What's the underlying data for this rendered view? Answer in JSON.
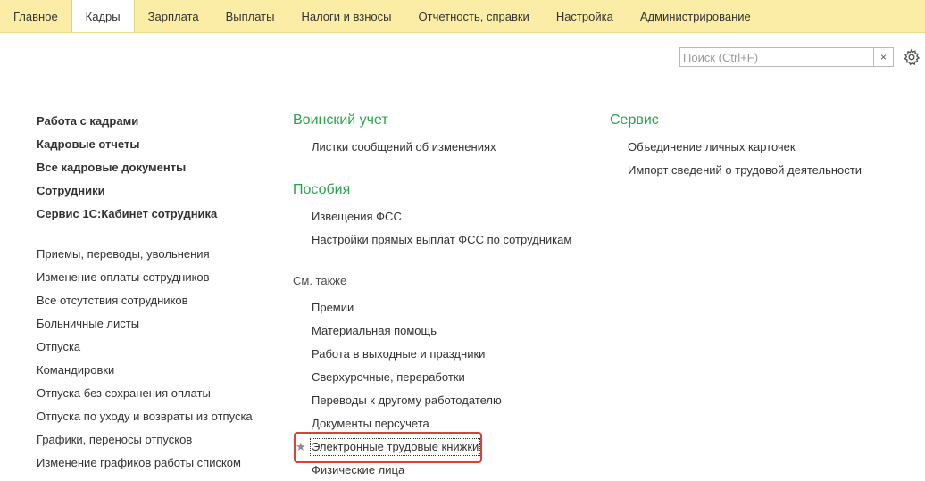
{
  "menubar": {
    "items": [
      {
        "label": "Главное",
        "active": false
      },
      {
        "label": "Кадры",
        "active": true
      },
      {
        "label": "Зарплата",
        "active": false
      },
      {
        "label": "Выплаты",
        "active": false
      },
      {
        "label": "Налоги и взносы",
        "active": false
      },
      {
        "label": "Отчетность, справки",
        "active": false
      },
      {
        "label": "Настройка",
        "active": false
      },
      {
        "label": "Администрирование",
        "active": false
      }
    ]
  },
  "search": {
    "placeholder": "Поиск (Ctrl+F)",
    "value": "",
    "clear_label": "×"
  },
  "left_column": {
    "bold_links": [
      "Работа с кадрами",
      "Кадровые отчеты",
      "Все кадровые документы",
      "Сотрудники",
      "Сервис 1С:Кабинет сотрудника"
    ],
    "links": [
      "Приемы, переводы, увольнения",
      "Изменение оплаты сотрудников",
      "Все отсутствия сотрудников",
      "Больничные листы",
      "Отпуска",
      "Командировки",
      "Отпуска без сохранения оплаты",
      "Отпуска по уходу и возвраты из отпуска",
      "Графики, переносы отпусков",
      "Изменение графиков работы списком"
    ]
  },
  "middle_column": {
    "military": {
      "title": "Воинский учет",
      "links": [
        "Листки сообщений об изменениях"
      ]
    },
    "benefits": {
      "title": "Пособия",
      "links": [
        "Извещения ФСС",
        "Настройки прямых выплат ФСС по сотрудникам"
      ]
    },
    "see_also": {
      "title": "См. также",
      "links": [
        "Премии",
        "Материальная помощь",
        "Работа в выходные и праздники",
        "Сверхурочные, переработки",
        "Переводы к другому работодателю",
        "Документы персучета",
        "Электронные трудовые книжки",
        "Физические лица"
      ],
      "star_icon": "★"
    }
  },
  "right_column": {
    "service": {
      "title": "Сервис",
      "links": [
        "Объединение личных карточек",
        "Импорт сведений о трудовой деятельности"
      ]
    }
  },
  "colors": {
    "menubar_bg": "#fbeda5",
    "section_title": "#27a449",
    "highlight": "#d9413a"
  }
}
